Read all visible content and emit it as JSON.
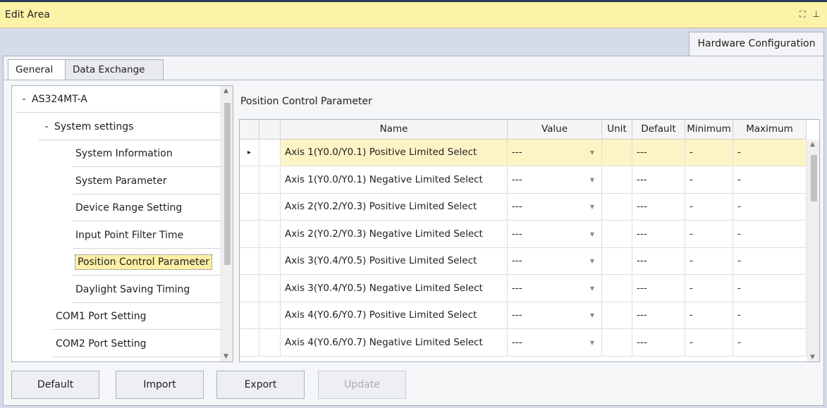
{
  "window": {
    "title": "Edit Area",
    "icons": [
      "maximize-icon",
      "pin-icon"
    ]
  },
  "top_tab": "Hardware Configuration",
  "subtabs": [
    "General",
    "Data Exchange"
  ],
  "tree": {
    "nodes": [
      {
        "expander": "-",
        "label": "AS324MT-A"
      },
      {
        "expander": "-",
        "label": "System settings"
      },
      {
        "expander": "",
        "label": "System Information"
      },
      {
        "expander": "",
        "label": "System Parameter"
      },
      {
        "expander": "",
        "label": "Device Range Setting"
      },
      {
        "expander": "",
        "label": "Input Point Filter Time"
      },
      {
        "expander": "",
        "label": "Position Control Parameter",
        "selected": true
      },
      {
        "expander": "",
        "label": "Daylight Saving Timing"
      },
      {
        "expander": "",
        "label": "COM1 Port Setting"
      },
      {
        "expander": "",
        "label": "COM2 Port Setting"
      }
    ]
  },
  "section_title": "Position Control Parameter",
  "table": {
    "columns": [
      "Name",
      "Value",
      "Unit",
      "Default",
      "Minimum",
      "Maximum"
    ],
    "row_indicator": "▸",
    "rows": [
      {
        "name": "Axis 1(Y0.0/Y0.1) Positive Limited Select",
        "value": "---",
        "unit": "",
        "default": "---",
        "minimum": "-",
        "maximum": "-"
      },
      {
        "name": "Axis 1(Y0.0/Y0.1) Negative Limited Select",
        "value": "---",
        "unit": "",
        "default": "---",
        "minimum": "-",
        "maximum": "-"
      },
      {
        "name": "Axis 2(Y0.2/Y0.3) Positive Limited Select",
        "value": "---",
        "unit": "",
        "default": "---",
        "minimum": "-",
        "maximum": "-"
      },
      {
        "name": "Axis 2(Y0.2/Y0.3) Negative Limited Select",
        "value": "---",
        "unit": "",
        "default": "---",
        "minimum": "-",
        "maximum": "-"
      },
      {
        "name": "Axis 3(Y0.4/Y0.5) Positive Limited Select",
        "value": "---",
        "unit": "",
        "default": "---",
        "minimum": "-",
        "maximum": "-"
      },
      {
        "name": "Axis 3(Y0.4/Y0.5) Negative Limited Select",
        "value": "---",
        "unit": "",
        "default": "---",
        "minimum": "-",
        "maximum": "-"
      },
      {
        "name": "Axis 4(Y0.6/Y0.7) Positive Limited Select",
        "value": "---",
        "unit": "",
        "default": "---",
        "minimum": "-",
        "maximum": "-"
      },
      {
        "name": "Axis 4(Y0.6/Y0.7) Negative Limited Select",
        "value": "---",
        "unit": "",
        "default": "---",
        "minimum": "-",
        "maximum": "-"
      }
    ]
  },
  "buttons": {
    "default": "Default",
    "import": "Import",
    "export": "Export",
    "update": "Update"
  },
  "colors": {
    "titlebar": "#fdf3a8",
    "selection": "#fdf0a6",
    "background": "#d6dbe9"
  }
}
